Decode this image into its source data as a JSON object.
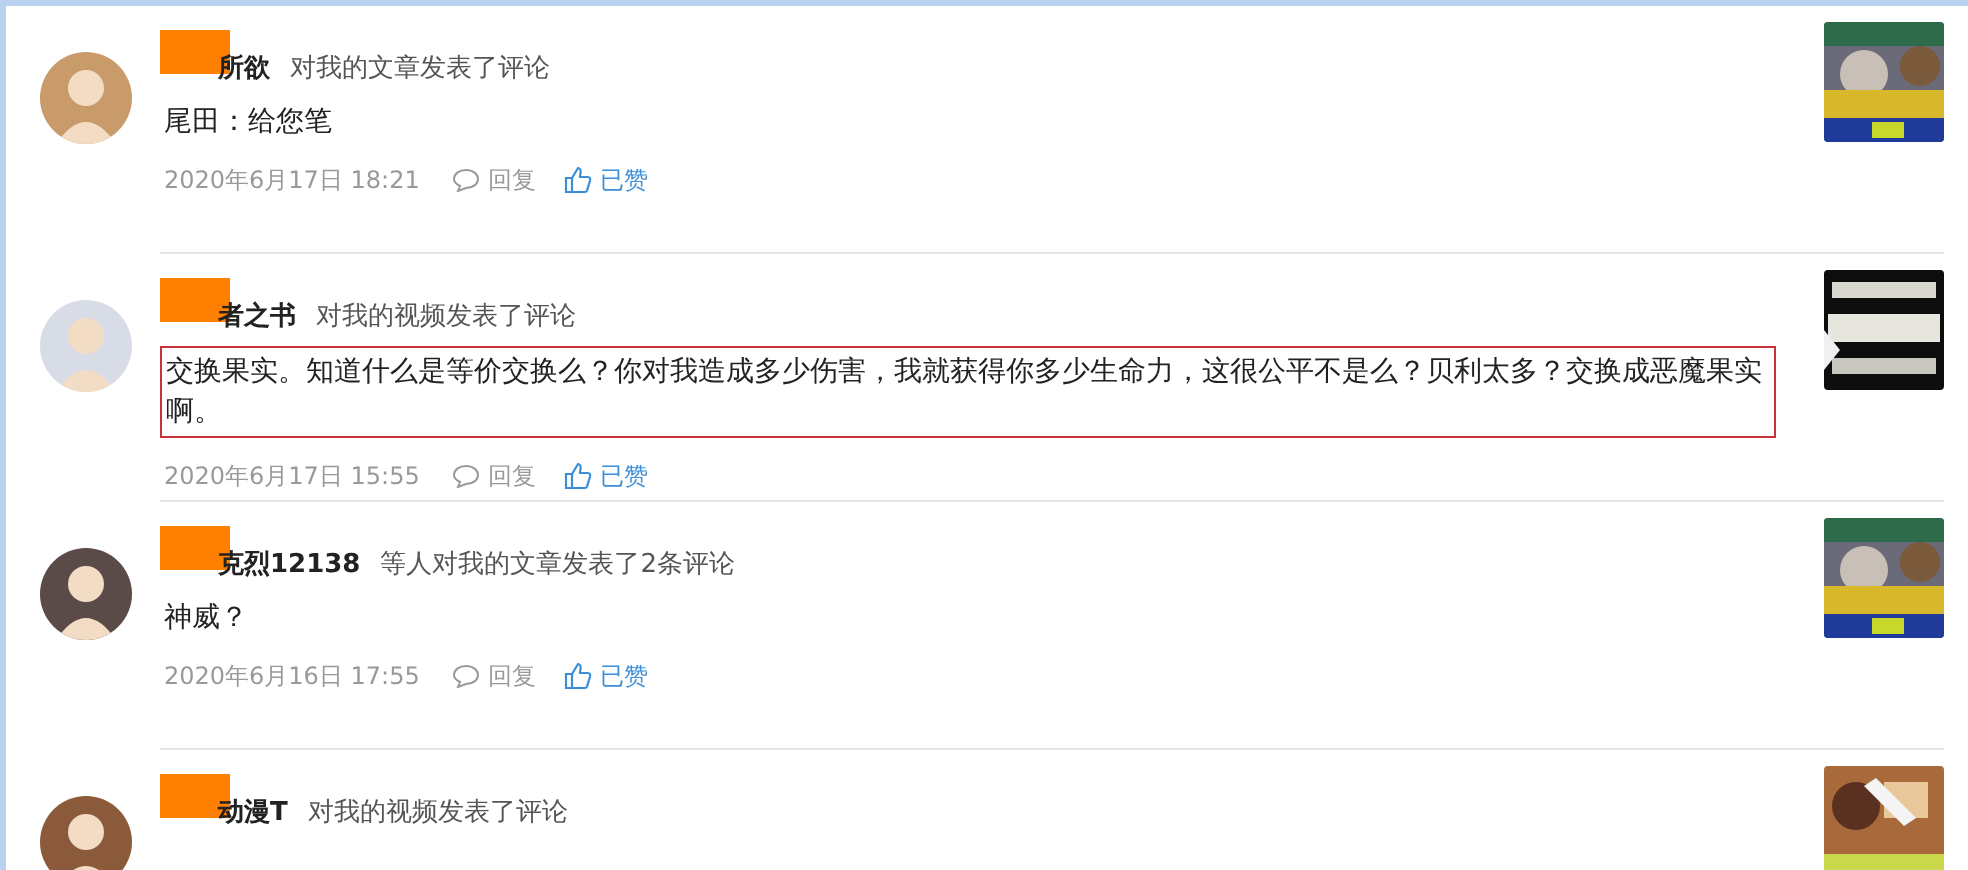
{
  "notifications": [
    {
      "name": "所欲",
      "action": "对我的文章发表了评论",
      "text": "尾田：给您笔",
      "highlighted": false,
      "time": "2020年6月17日 18:21",
      "reply": "回复",
      "like": "已赞",
      "liked": true
    },
    {
      "name": "者之书",
      "action": "对我的视频发表了评论",
      "text": "交换果实。知道什么是等价交换么？你对我造成多少伤害，我就获得你多少生命力，这很公平不是么？贝利太多？交换成恶魔果实啊。",
      "highlighted": true,
      "time": "2020年6月17日 15:55",
      "reply": "回复",
      "like": "已赞",
      "liked": true
    },
    {
      "name": "克烈12138",
      "action": "等人对我的文章发表了2条评论",
      "text": "神威？",
      "highlighted": false,
      "time": "2020年6月16日 17:55",
      "reply": "回复",
      "like": "已赞",
      "liked": true
    },
    {
      "name": "动漫T",
      "action": "对我的视频发表了评论"
    }
  ]
}
